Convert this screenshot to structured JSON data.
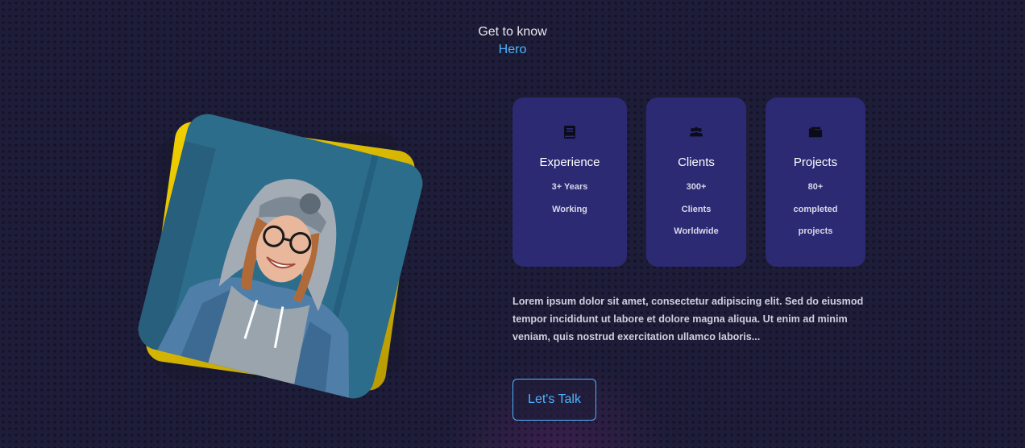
{
  "header": {
    "subtitle": "Get to know",
    "title": "Hero"
  },
  "portrait": {
    "alt": "Smiling woman in a beanie and denim jacket",
    "accent_color": "#f1d000"
  },
  "cards": [
    {
      "icon": "book-icon",
      "title": "Experience",
      "lines": [
        "3+ Years",
        "Working"
      ]
    },
    {
      "icon": "users-icon",
      "title": "Clients",
      "lines": [
        "300+",
        "Clients",
        "Worldwide"
      ]
    },
    {
      "icon": "folder-icon",
      "title": "Projects",
      "lines": [
        "80+",
        "completed",
        "projects"
      ]
    }
  ],
  "about": {
    "text": "Lorem ipsum dolor sit amet, consectetur adipiscing elit. Sed do eiusmod tempor incididunt ut labore et dolore magna aliqua. Ut enim ad minim veniam, quis nostrud exercitation ullamco laboris..."
  },
  "cta": {
    "label": "Let's Talk"
  },
  "colors": {
    "background": "#1e1d39",
    "card": "#2c2a73",
    "accent": "#4db5ff"
  }
}
